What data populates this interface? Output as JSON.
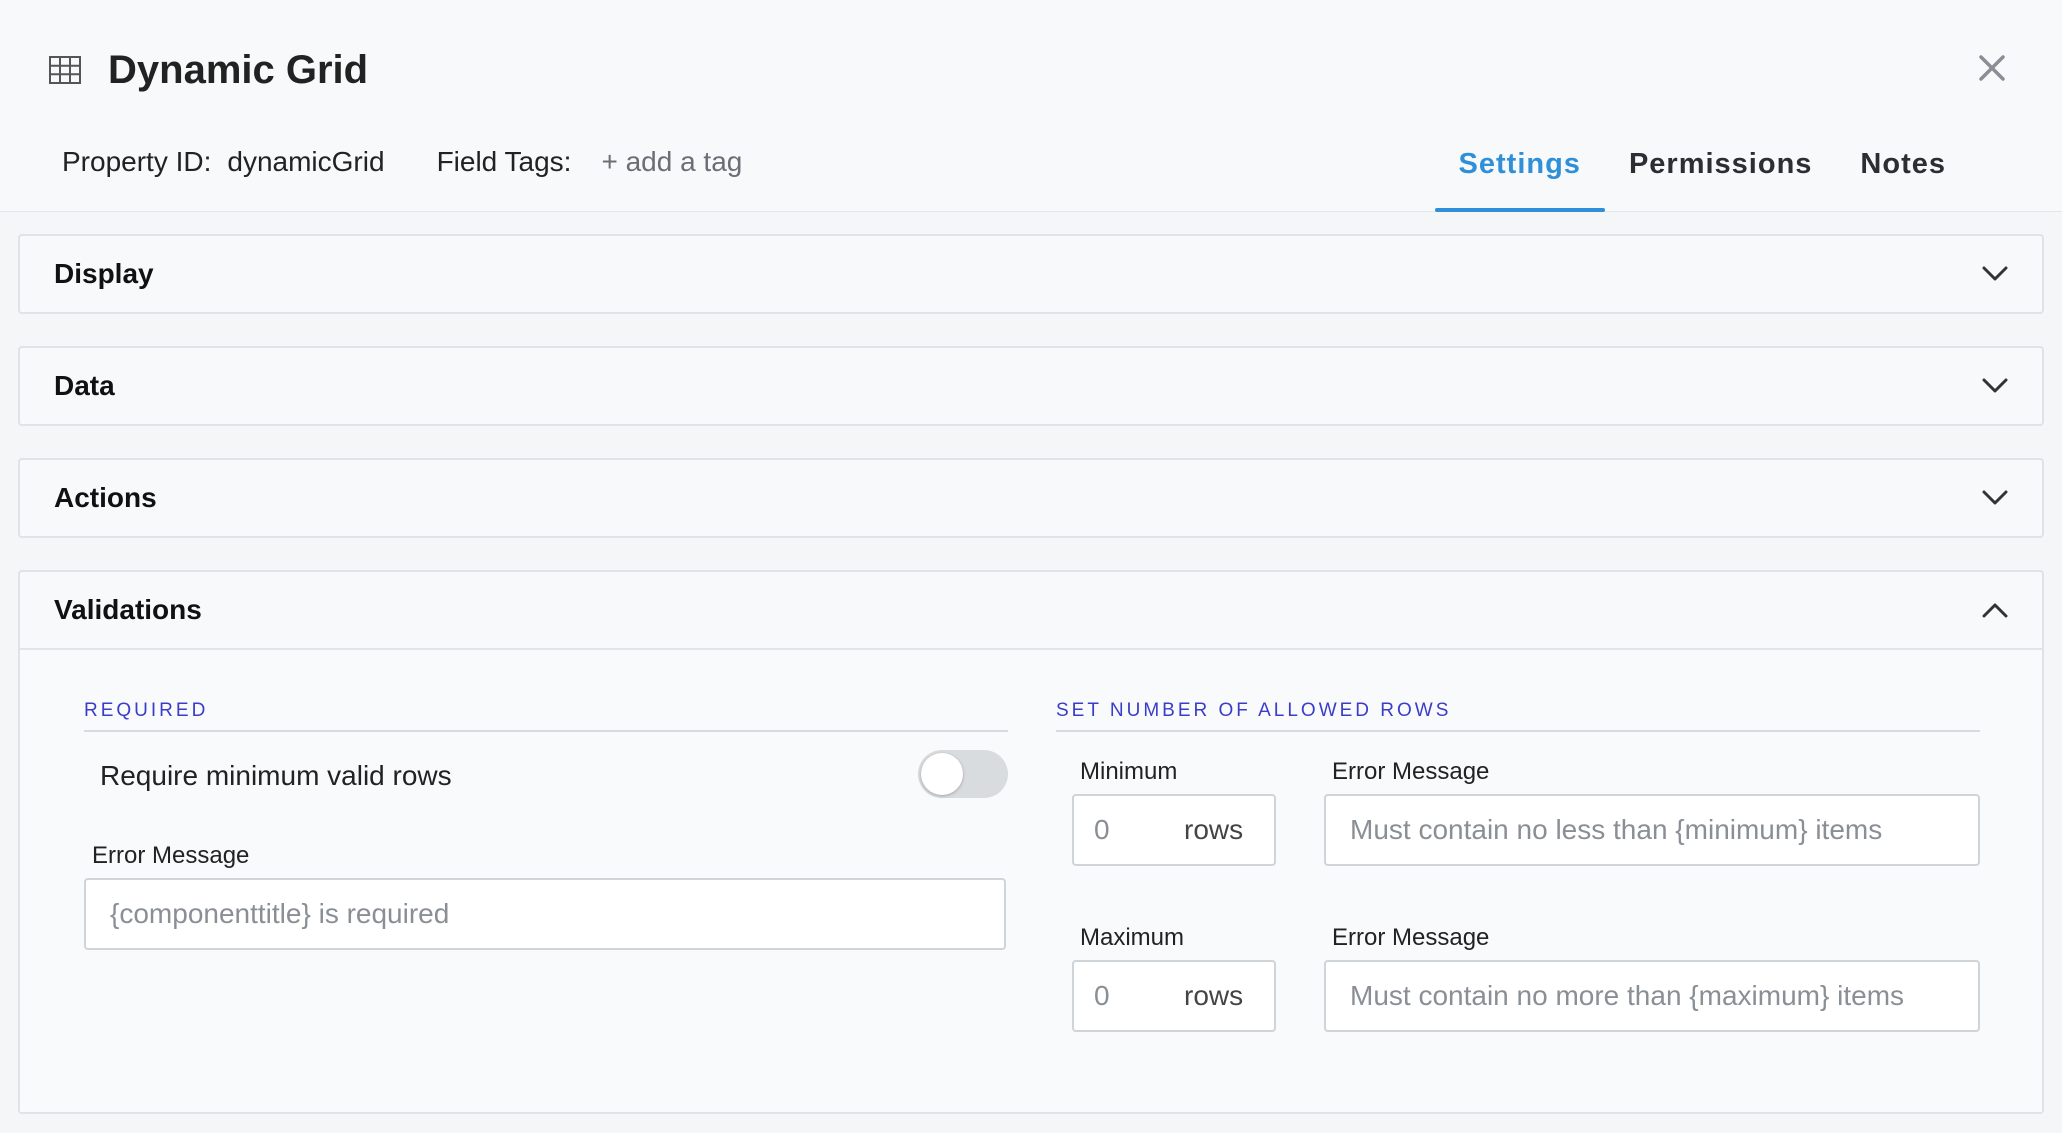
{
  "modal": {
    "title": "Dynamic Grid",
    "property_id_label": "Property ID:",
    "property_id_value": "dynamicGrid",
    "field_tags_label": "Field Tags:",
    "add_tag_label": "+ add a tag",
    "tabs": [
      {
        "label": "Settings",
        "active": true
      },
      {
        "label": "Permissions",
        "active": false
      },
      {
        "label": "Notes",
        "active": false
      }
    ]
  },
  "sections": {
    "display": "Display",
    "data": "Data",
    "actions": "Actions",
    "validations": "Validations"
  },
  "validations": {
    "required_heading": "REQUIRED",
    "require_min_rows_label": "Require minimum valid rows",
    "require_min_rows_enabled": false,
    "required_error_label": "Error Message",
    "required_error_placeholder": "{componenttitle} is required",
    "rows_heading": "SET NUMBER OF ALLOWED ROWS",
    "minimum_label": "Minimum",
    "minimum_placeholder": "0",
    "minimum_suffix": "rows",
    "minimum_error_label": "Error Message",
    "minimum_error_placeholder": "Must contain no less than {minimum} items",
    "maximum_label": "Maximum",
    "maximum_placeholder": "0",
    "maximum_suffix": "rows",
    "maximum_error_label": "Error Message",
    "maximum_error_placeholder": "Must contain no more than {maximum} items"
  },
  "colors": {
    "accent": "#2f8fd8",
    "group_heading": "#3b3dc8"
  },
  "icons": {
    "title": "grid-icon",
    "close": "close-icon",
    "collapsed": "chevron-down-icon",
    "expanded": "chevron-up-icon"
  }
}
